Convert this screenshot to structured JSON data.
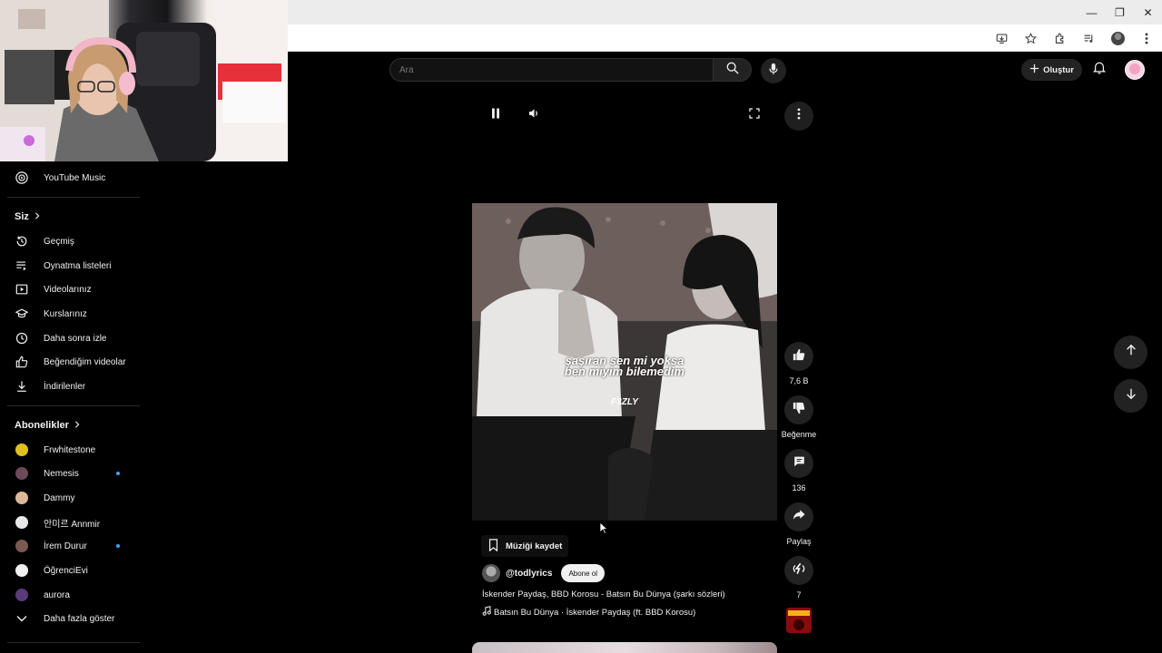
{
  "masthead": {
    "search_placeholder": "Ara",
    "create_label": "Oluştur"
  },
  "sidebar": {
    "music_item": "YouTube Music",
    "you_header": "Siz",
    "you_items": [
      {
        "label": "Geçmiş",
        "icon": "history-icon"
      },
      {
        "label": "Oynatma listeleri",
        "icon": "playlists-icon"
      },
      {
        "label": "Videolarınız",
        "icon": "your-videos-icon"
      },
      {
        "label": "Kurslarınız",
        "icon": "courses-icon"
      },
      {
        "label": "Daha sonra izle",
        "icon": "watch-later-icon"
      },
      {
        "label": "Beğendiğim videolar",
        "icon": "liked-videos-icon"
      },
      {
        "label": "İndirilenler",
        "icon": "downloads-icon"
      }
    ],
    "subs_header": "Abonelikler",
    "subscriptions": [
      {
        "name": "Frwhitestone",
        "color": "#e0c020",
        "new": false
      },
      {
        "name": "Nemesis",
        "color": "#6b4a5a",
        "new": true
      },
      {
        "name": "Dammy",
        "color": "#d9b99a",
        "new": false
      },
      {
        "name": "안미르 Annmir",
        "color": "#e8e8e8",
        "new": false
      },
      {
        "name": "İrem Durur",
        "color": "#7a5a50",
        "new": true
      },
      {
        "name": "ÖğrenciEvi",
        "color": "#f1f1f1",
        "new": false
      },
      {
        "name": "aurora",
        "color": "#5a3a7a",
        "new": false
      }
    ],
    "show_more": "Daha fazla göster"
  },
  "short": {
    "lyric_line1": "şaşıran sen mi yoksa",
    "lyric_line2": "ben miyim bilemedim",
    "lyric_tag": "F3ZLY",
    "save_music": "Müziği kaydet",
    "channel": "@todlyrics",
    "subscribe": "Abone ol",
    "title": "İskender Paydaş, BBD Korosu - Batsın Bu Dünya (şarkı sözleri)",
    "music": "Batsın Bu Dünya · İskender Paydaş (ft. BBD Korosu)"
  },
  "actions": {
    "likes": "7,6 B",
    "dislike": "Beğenme",
    "comments": "136",
    "share": "Paylaş",
    "remix": "7"
  },
  "colors": {
    "accent": "#3ea6ff",
    "background": "#000000",
    "button_bg": "#222222"
  }
}
